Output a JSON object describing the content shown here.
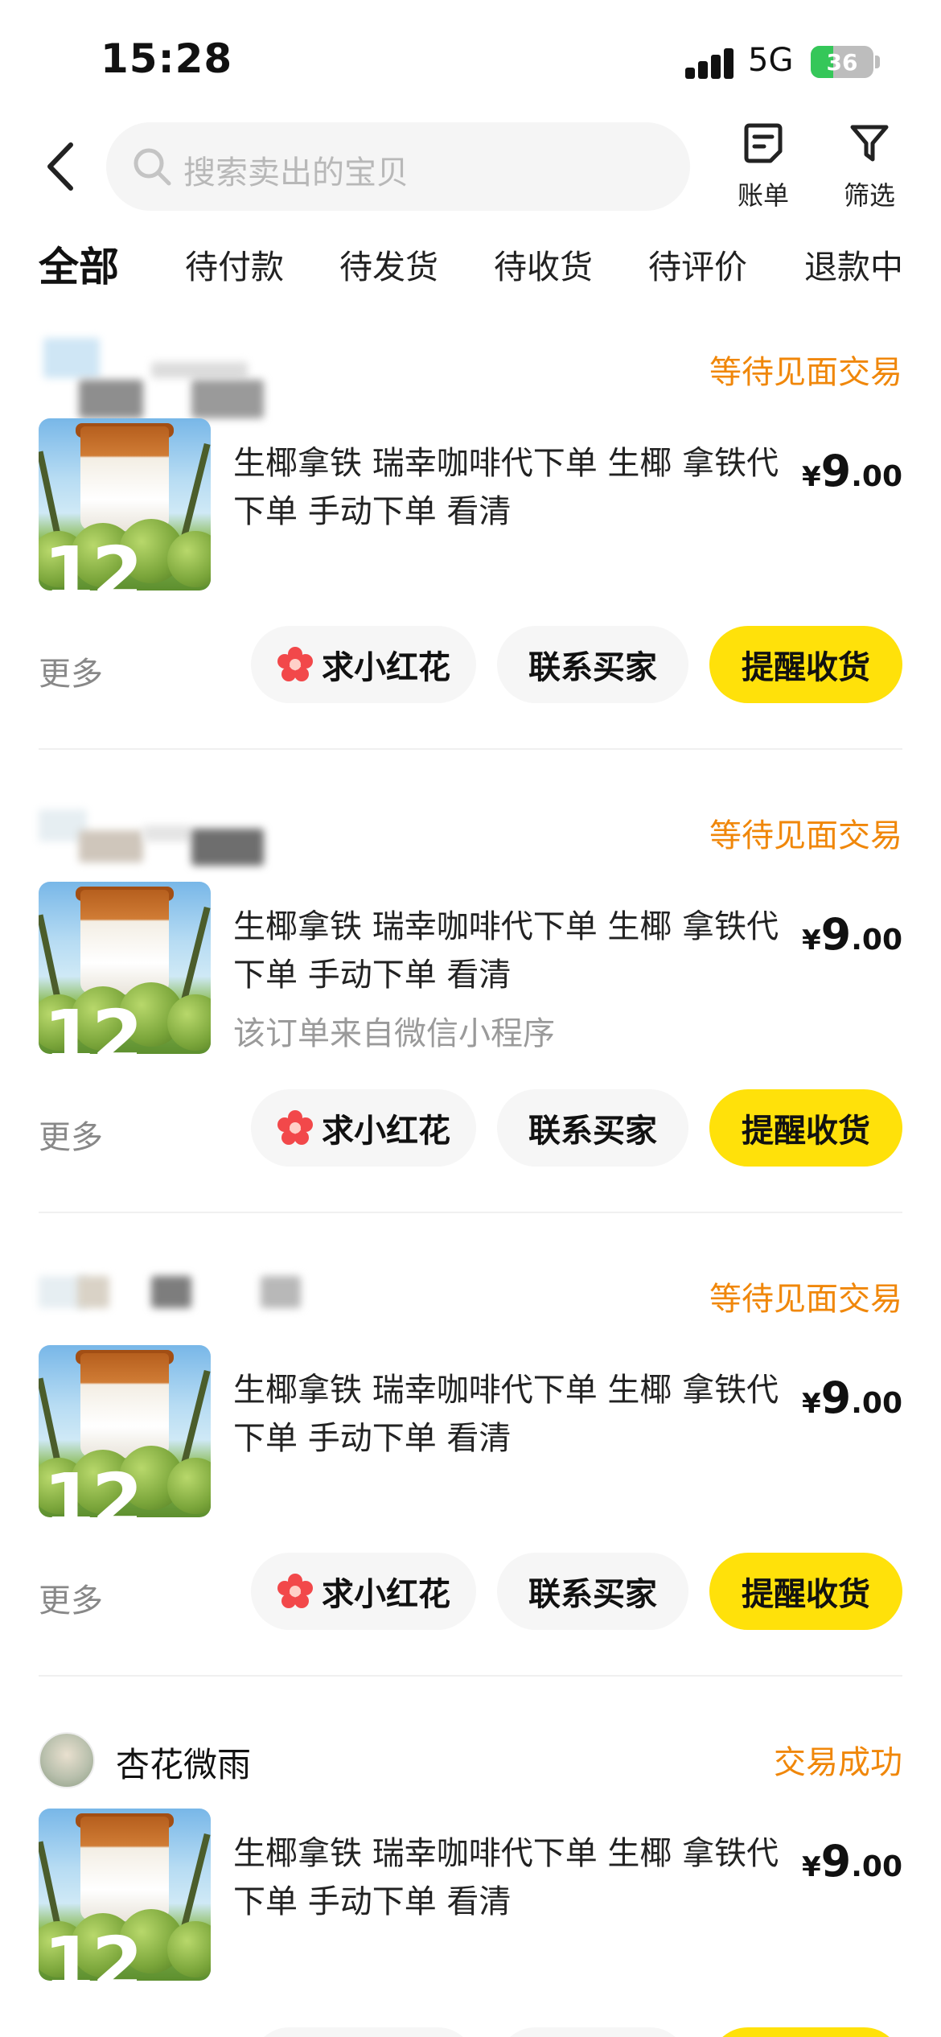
{
  "status_bar": {
    "time": "15:28",
    "network": "5G",
    "battery": "36",
    "battery_level": 0.36
  },
  "header": {
    "search_placeholder": "搜索卖出的宝贝",
    "bill_label": "账单",
    "filter_label": "筛选"
  },
  "tabs": [
    {
      "label": "全部",
      "active": true
    },
    {
      "label": "待付款"
    },
    {
      "label": "待发货"
    },
    {
      "label": "待收货"
    },
    {
      "label": "待评价"
    },
    {
      "label": "退款中"
    }
  ],
  "orders": [
    {
      "seller": "",
      "status": "等待见面交易",
      "title": "生椰拿铁 瑞幸咖啡代下单 生椰 拿铁代下单 手动下单 看清",
      "subtitle": "",
      "price_symbol": "¥",
      "price_int": "9",
      "price_dec": ".00",
      "more": "更多",
      "btn_flower": "求小红花",
      "btn_contact": "联系买家",
      "btn_remind": "提醒收货",
      "thumb_number": "12"
    },
    {
      "seller": "",
      "status": "等待见面交易",
      "title": "生椰拿铁 瑞幸咖啡代下单 生椰 拿铁代下单 手动下单 看清",
      "subtitle": "该订单来自微信小程序",
      "price_symbol": "¥",
      "price_int": "9",
      "price_dec": ".00",
      "more": "更多",
      "btn_flower": "求小红花",
      "btn_contact": "联系买家",
      "btn_remind": "提醒收货",
      "thumb_number": "12"
    },
    {
      "seller": "",
      "status": "等待见面交易",
      "title": "生椰拿铁 瑞幸咖啡代下单 生椰 拿铁代下单 手动下单 看清",
      "subtitle": "",
      "price_symbol": "¥",
      "price_int": "9",
      "price_dec": ".00",
      "more": "更多",
      "btn_flower": "求小红花",
      "btn_contact": "联系买家",
      "btn_remind": "提醒收货",
      "thumb_number": "12"
    },
    {
      "seller": "杏花微雨",
      "status": "交易成功",
      "title": "生椰拿铁 瑞幸咖啡代下单 生椰 拿铁代下单 手动下单 看清",
      "subtitle": "",
      "price_symbol": "¥",
      "price_int": "9",
      "price_dec": ".00",
      "thumb_number": "12"
    }
  ],
  "colors": {
    "accent_yellow": "#ffe10a",
    "status_orange": "#f0870a",
    "flower_red": "#f2484a"
  }
}
